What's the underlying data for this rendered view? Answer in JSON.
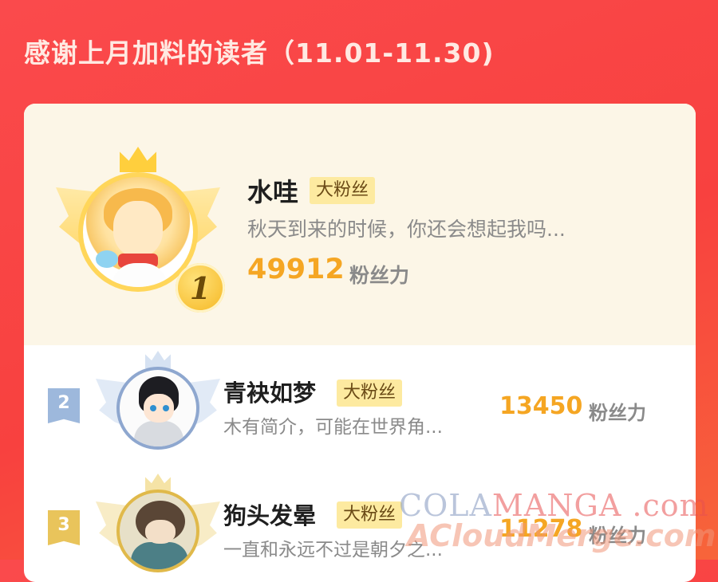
{
  "page": {
    "title": "感谢上月加料的读者（11.01-11.30)"
  },
  "ranking": [
    {
      "rank": "1",
      "name": "水哇",
      "badge": "大粉丝",
      "bio": "秋天到来的时候，你还会想起我吗...",
      "score": "49912",
      "unit": "粉丝力"
    },
    {
      "rank": "2",
      "name": "青袂如梦",
      "badge": "大粉丝",
      "bio": "木有简介，可能在世界角...",
      "score": "13450",
      "unit": "粉丝力"
    },
    {
      "rank": "3",
      "name": "狗头发晕",
      "badge": "大粉丝",
      "bio": "一直和永远不过是朝夕之...",
      "score": "11278",
      "unit": "粉丝力"
    }
  ],
  "watermark": {
    "line1_part1": "COLA",
    "line1_part2": "MANGA",
    "line1_part3": " .com",
    "line2": "ACloudMerge.com"
  },
  "colors": {
    "background_top": "#fa4a4c",
    "background_bottom": "#f7653a",
    "score": "#f5a623",
    "badge_bg": "#fdeaa0",
    "rank2": "#9db8dc",
    "rank3": "#e9c45b"
  }
}
